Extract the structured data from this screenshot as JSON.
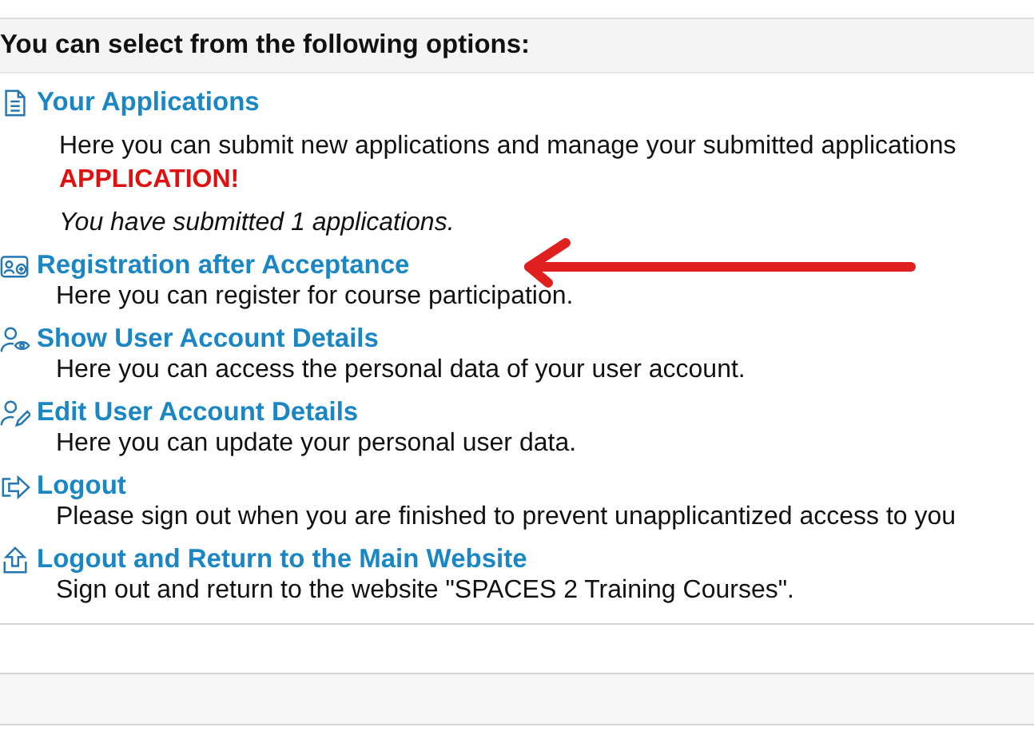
{
  "heading": "You can select from the following options:",
  "options": [
    {
      "kind": "document",
      "title": "Your Applications",
      "description": "Here you can submit new applications and manage your submitted applications",
      "warning": "APPLICATION!",
      "note": "You have submitted 1 applications."
    },
    {
      "kind": "registration",
      "title": "Registration after Acceptance",
      "description": "Here you can register for course participation."
    },
    {
      "kind": "show-user",
      "title": "Show User Account Details",
      "description": "Here you can access the personal data of your user account."
    },
    {
      "kind": "edit-user",
      "title": "Edit User Account Details",
      "description": "Here you can update your personal user data."
    },
    {
      "kind": "logout",
      "title": "Logout",
      "description": "Please sign out when you are finished to prevent unapplicantized access to you"
    },
    {
      "kind": "return",
      "title": "Logout and Return to the Main Website",
      "description": "Sign out and return to the website \"SPACES 2 Training Courses\"."
    }
  ],
  "annotation": {
    "kind": "arrow"
  }
}
